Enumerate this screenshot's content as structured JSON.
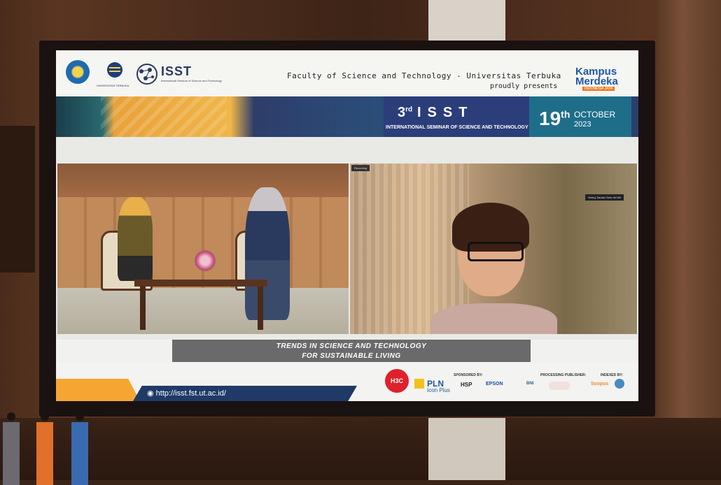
{
  "screen": {
    "header": {
      "faculty_line": "Faculty of Science and Technology - Universitas Terbuka",
      "presents": "proudly presents",
      "isst_logo": "ISST",
      "isst_logo_sub": "International Seminar of Science and Technology",
      "ut_caption": "UNIVERSITAS TERBUKA",
      "campaign_logo": "Kampus Merdeka",
      "campaign_sub": "INDONESIA JAYA"
    },
    "banner": {
      "ordinal": "3",
      "ordinal_suffix": "rd",
      "event": "ISST",
      "event_full": "INTERNATIONAL SEMINAR OF SCIENCE AND TECHNOLOGY",
      "day": "19",
      "day_suffix": "th",
      "month": "OCTOBER",
      "year": "2023"
    },
    "video": {
      "left_tag": "Recording",
      "right_tag": "Sebuy Saulan Setu del Me"
    },
    "caption": {
      "line1": "TRENDS IN SCIENCE AND TECHNOLOGY",
      "line2": "FOR SUSTAINABLE LIVING"
    },
    "footer": {
      "url": "http://isst.fst.ut.ac.id/",
      "sponsored_by": "SPONSORED BY:",
      "processing_publisher": "PROCESSING PUBLISHER:",
      "indexed_by": "INDEXED BY:",
      "sponsors": [
        "H3C",
        "PLN",
        "Icon Plus",
        "HSP",
        "EPSON",
        "BNI"
      ],
      "indexers": [
        "Scopus"
      ]
    }
  },
  "colors": {
    "wall": "#3a2418",
    "banner_blue": "#2b3e7a",
    "date_teal": "#1e6e8a",
    "footer_orange": "#f5a532",
    "footer_blue": "#1f3a66",
    "h3c_red": "#e0202a"
  }
}
